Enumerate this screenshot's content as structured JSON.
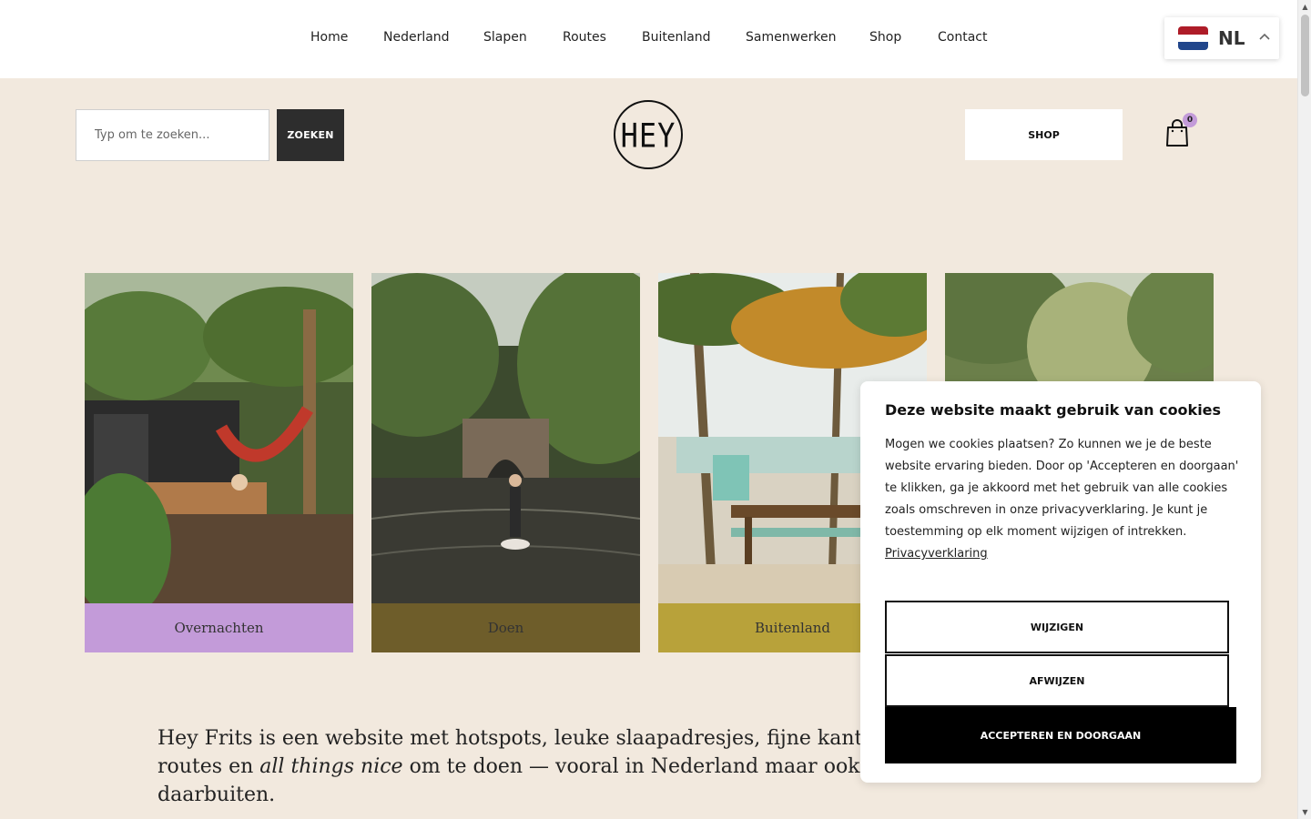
{
  "nav": {
    "items": [
      "Home",
      "Nederland",
      "Slapen",
      "Routes",
      "Buitenland",
      "Samenwerken",
      "Shop",
      "Contact"
    ]
  },
  "language": {
    "code": "NL",
    "flag_icon": "netherlands-flag-icon"
  },
  "search": {
    "placeholder": "Typ om te zoeken...",
    "button_label": "ZOEKEN"
  },
  "logo": {
    "text": "HEY"
  },
  "header": {
    "shop_label": "SHOP",
    "cart_count": "0"
  },
  "cards": [
    {
      "label": "Overnachten",
      "color": "#c39bd9"
    },
    {
      "label": "Doen",
      "color": "#6e5d2a"
    },
    {
      "label": "Buitenland",
      "color": "#b8a23a"
    },
    {
      "label": "",
      "color": "#6b7f4a"
    }
  ],
  "intro": {
    "part1": "Hey Frits is een website met hotspots, leuke slaapadresjes, fijne kant-en-k",
    "part2": "routes en ",
    "emph": "all things nice",
    "part3": " om te doen — vooral in Nederland maar ook af e",
    "part4": "daarbuiten."
  },
  "cookie": {
    "title": "Deze website maakt gebruik van cookies",
    "body": "Mogen we cookies plaatsen? Zo kunnen we je de beste website ervaring bieden. Door op 'Accepteren en doorgaan' te klikken, ga je akkoord met het gebruik van alle cookies zoals omschreven in onze privacyverklaring. Je kunt je toestemming op elk moment wijzigen of intrekken. ",
    "link": "Privacyverklaring",
    "change_label": "WIJZIGEN",
    "decline_label": "AFWIJZEN",
    "accept_label": "ACCEPTEREN EN DOORGAAN"
  },
  "colors": {
    "page_bg": "#f2e9de",
    "accent_purple": "#c39bd9",
    "dark_button": "#2d2d2d"
  }
}
